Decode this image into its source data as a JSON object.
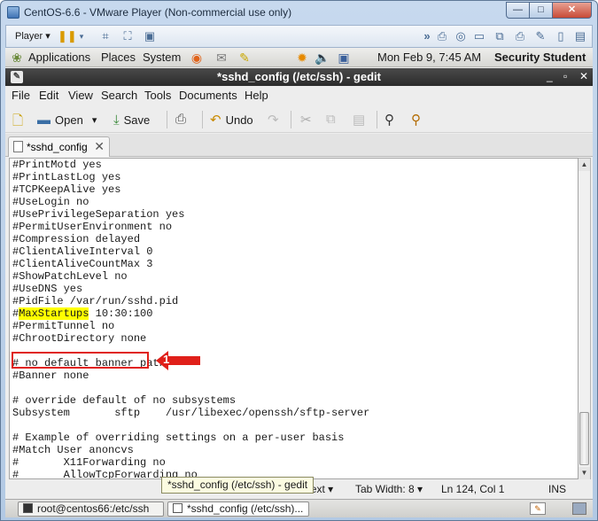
{
  "vm": {
    "title": "CentOS-6.6 - VMware Player (Non-commercial use only)",
    "player_label": "Player",
    "minimize": "—",
    "maximize": "□",
    "close": "✕"
  },
  "gnome_panel": {
    "applications": "Applications",
    "places": "Places",
    "system": "System",
    "datetime": "Mon Feb  9,  7:45 AM",
    "user": "Security Student"
  },
  "gedit": {
    "title": "*sshd_config (/etc/ssh) - gedit",
    "menu": [
      "File",
      "Edit",
      "View",
      "Search",
      "Tools",
      "Documents",
      "Help"
    ],
    "toolbar": {
      "open": "Open",
      "save": "Save",
      "undo": "Undo"
    },
    "tab_label": "*sshd_config",
    "lines": [
      "#PrintMotd yes",
      "#PrintLastLog yes",
      "#TCPKeepAlive yes",
      "#UseLogin no",
      "#UsePrivilegeSeparation yes",
      "#PermitUserEnvironment no",
      "#Compression delayed",
      "#ClientAliveInterval 0",
      "#ClientAliveCountMax 3",
      "#ShowPatchLevel no",
      "#UseDNS yes",
      "#PidFile /var/run/sshd.pid",
      "#MaxStartups 10:30:100",
      "#PermitTunnel no",
      "#ChrootDirectory none",
      "",
      "# no default banner path",
      "#Banner none",
      "",
      "# override default of no subsystems",
      "Subsystem       sftp    /usr/libexec/openssh/sftp-server",
      "",
      "# Example of overriding settings on a per-user basis",
      "#Match User anoncvs",
      "#       X11Forwarding no",
      "#       AllowTcpForwarding no"
    ],
    "highlight": {
      "prefix": "#",
      "word": "MaxStartups",
      "suffix": " 10:30:100"
    },
    "status": {
      "language": "Plain Text",
      "tab_width": "Tab Width:  8",
      "position": "Ln 124, Col 1",
      "mode": "INS"
    },
    "tooltip": "*sshd_config (/etc/ssh) - gedit"
  },
  "taskbar": {
    "terminal": "root@centos66:/etc/ssh",
    "gedit": "*sshd_config (/etc/ssh)..."
  },
  "annotation": {
    "number": "1",
    "color": "#e0201a"
  }
}
